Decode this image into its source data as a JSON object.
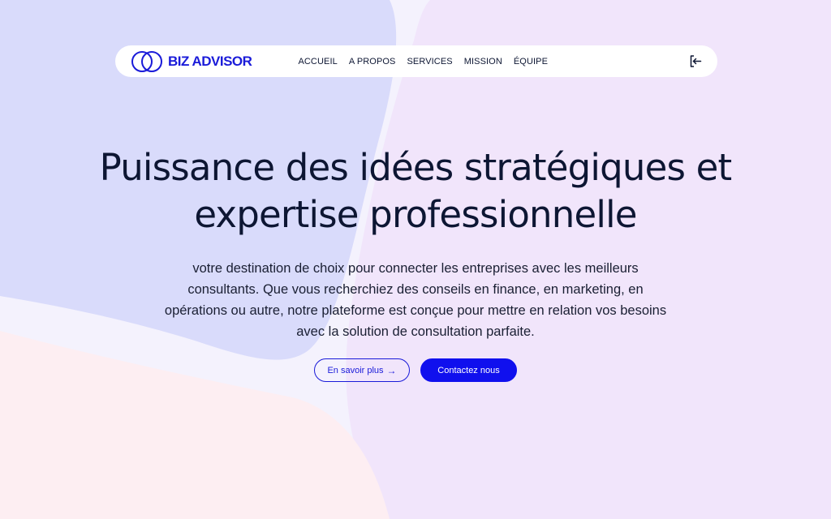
{
  "brand": {
    "name": "BIZ ADVISOR",
    "color": "#1a1bd9"
  },
  "nav": {
    "items": [
      {
        "label": "ACCUEIL"
      },
      {
        "label": "A PROPOS"
      },
      {
        "label": "SERVICES"
      },
      {
        "label": "MISSION"
      },
      {
        "label": "ÉQUIPE"
      }
    ],
    "login_icon": "login-icon"
  },
  "hero": {
    "title": "Puissance des idées stratégiques et expertise professionnelle",
    "subtitle": "votre destination de choix pour connecter les entreprises avec les meilleurs consultants. Que vous recherchiez des conseils en finance, en marketing, en opérations ou autre, notre plateforme est conçue pour mettre en relation vos besoins avec la solution de consultation parfaite.",
    "primary_button": "En savoir plus",
    "primary_arrow": "→",
    "secondary_button": "Contactez nous"
  },
  "colors": {
    "accent": "#1010ee",
    "background_blue": "#d9dcfb",
    "background_purple": "#f1e6fb",
    "background_pink": "#fdeff2",
    "text": "#0d1633"
  }
}
